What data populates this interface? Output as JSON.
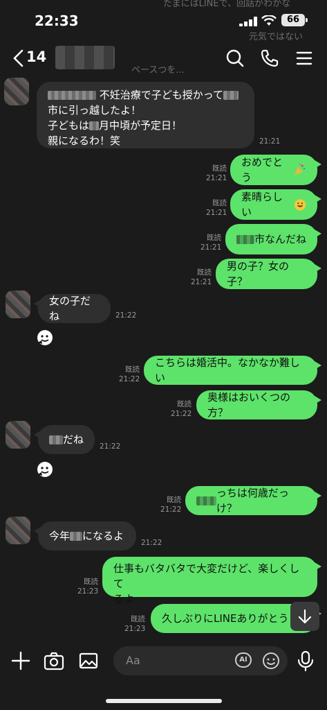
{
  "status": {
    "time": "22:33",
    "battery": "66"
  },
  "header": {
    "unread_count": "14"
  },
  "ghost": {
    "top1": "たまにはLINEで、回話がわかな",
    "top2": "元気ではない",
    "top3": "ペースつを..."
  },
  "messages": {
    "m1": {
      "part1": "不妊治療で子ども授かって",
      "part2": "市に引っ越したよ！",
      "part3a": "子どもは",
      "part3b": "月中頃が予定日！",
      "part4": "親になるわ！笑",
      "time": "21:21"
    },
    "m2": {
      "text": "おめでとう",
      "read": "既読",
      "time": "21:21"
    },
    "m3": {
      "text": "素晴らしい",
      "read": "既読",
      "time": "21:21"
    },
    "m4": {
      "text": "市なんだね",
      "read": "既読",
      "time": "21:21"
    },
    "m5": {
      "text": "男の子？女の子？",
      "read": "既読",
      "time": "21:21"
    },
    "m6": {
      "text": "女の子だね",
      "time": "21:22"
    },
    "m7": {
      "text": "こちらは婚活中。なかなか難しい",
      "read": "既読",
      "time": "21:22"
    },
    "m8": {
      "text": "奥様はおいくつの方？",
      "read": "既読",
      "time": "21:22"
    },
    "m9": {
      "text": "だね",
      "time": "21:22"
    },
    "m10": {
      "text": "っちは何歳だっけ？",
      "read": "既読",
      "time": "21:22"
    },
    "m11": {
      "part1": "今年",
      "part2": "になるよ",
      "time": "21:22"
    },
    "m12": {
      "line1": "仕事もバタバタで大変だけど、楽しくして",
      "line2": "るよ",
      "read": "既読",
      "time": "21:23"
    },
    "m13": {
      "text": "久しぶりにLINEありがとう",
      "read": "既読",
      "time": "21:23"
    }
  },
  "input": {
    "placeholder": "Aa",
    "ai_label": "AI"
  },
  "colors": {
    "sent_bubble": "#5de36a",
    "received_bubble": "#2f2f2f",
    "background": "#1b1b1b"
  }
}
